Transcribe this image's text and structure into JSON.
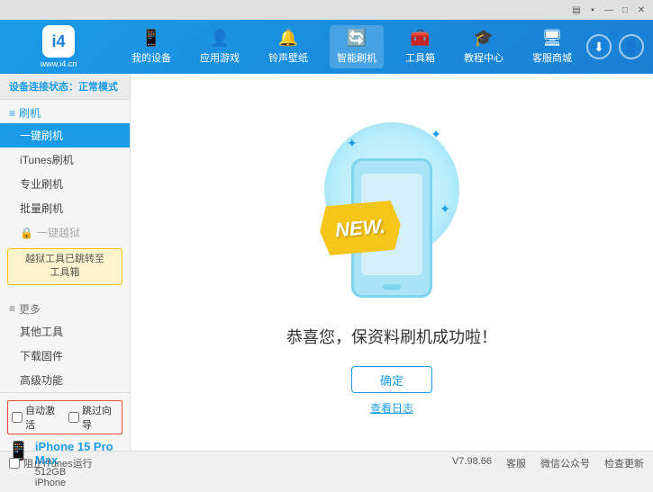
{
  "topbar": {
    "icons": [
      "wifi",
      "battery",
      "minimize",
      "maximize",
      "close"
    ]
  },
  "header": {
    "logo_text": "www.i4.cn",
    "logo_abbr": "i4",
    "nav_items": [
      {
        "label": "我的设备",
        "icon": "📱",
        "active": false
      },
      {
        "label": "应用游戏",
        "icon": "👤",
        "active": false
      },
      {
        "label": "铃声壁纸",
        "icon": "🔔",
        "active": false
      },
      {
        "label": "智能刷机",
        "icon": "🔄",
        "active": true
      },
      {
        "label": "工具箱",
        "icon": "🧰",
        "active": false
      },
      {
        "label": "教程中心",
        "icon": "🎓",
        "active": false
      },
      {
        "label": "客服商城",
        "icon": "🖥",
        "active": false
      }
    ]
  },
  "sidebar": {
    "status_label": "设备连接状态：",
    "status_value": "正常模式",
    "flash_section": "刷机",
    "items": [
      {
        "label": "一键刷机",
        "active": true
      },
      {
        "label": "iTunes刷机",
        "active": false
      },
      {
        "label": "专业刷机",
        "active": false
      },
      {
        "label": "批量刷机",
        "active": false
      }
    ],
    "disabled_item": "一键越狱",
    "notice_text": "越狱工具已跳转至\n工具箱",
    "more_section": "更多",
    "more_items": [
      {
        "label": "其他工具"
      },
      {
        "label": "下载固件"
      },
      {
        "label": "高级功能"
      }
    ],
    "checkbox_auto": "自动激活",
    "checkbox_guide": "跳过向导",
    "device_name": "iPhone 15 Pro Max",
    "device_storage": "512GB",
    "device_type": "iPhone"
  },
  "content": {
    "success_title": "恭喜您，保资料刷机成功啦！",
    "confirm_button": "确定",
    "log_link": "查看日志",
    "new_badge": "NEW."
  },
  "footer": {
    "itunes_label": "阻止iTunes运行",
    "version": "V7.98.66",
    "links": [
      "客服",
      "微信公众号",
      "检查更新"
    ]
  }
}
